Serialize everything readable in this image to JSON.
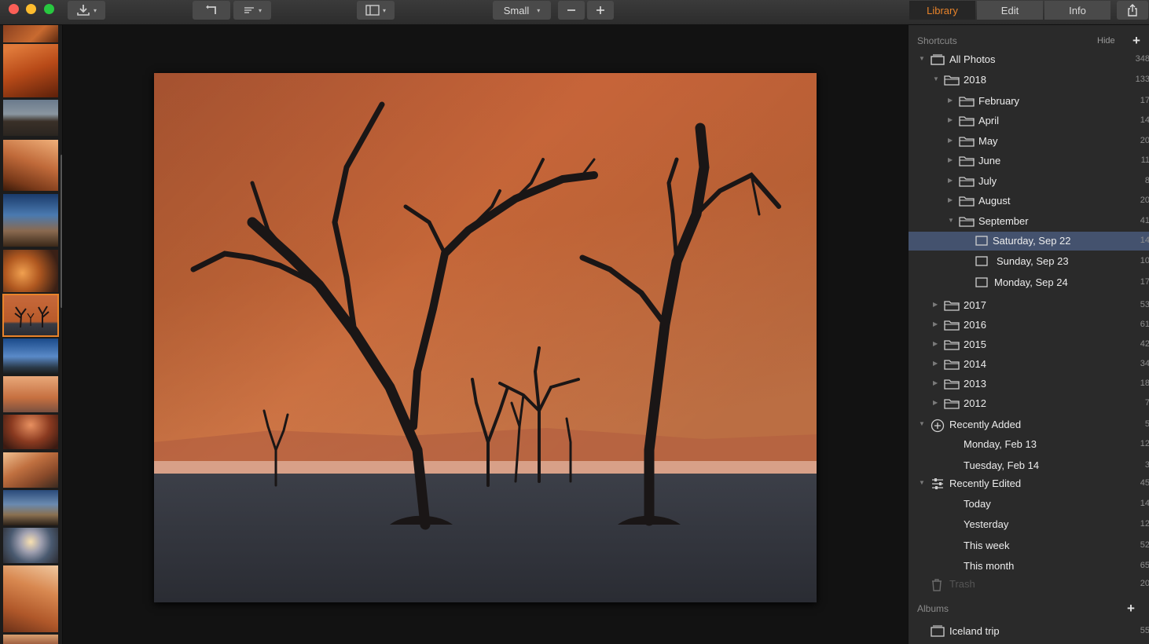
{
  "toolbar": {
    "size_select": "Small",
    "tabs": [
      {
        "label": "Library",
        "active": true
      },
      {
        "label": "Edit",
        "active": false
      },
      {
        "label": "Info",
        "active": false
      }
    ]
  },
  "colors": {
    "accent": "#e8832a",
    "selection": "#44526e",
    "sidebar_bg": "#2a2a2a",
    "viewer_bg": "#121212"
  },
  "filmstrip": {
    "selected_index": 6,
    "thumbnails": [
      "desert-dune-top",
      "desert-dune",
      "car-in-desert",
      "sand-dunes",
      "lightning-landscape",
      "abandoned-room",
      "dead-trees",
      "blue-sky-tree",
      "desert-trees",
      "rock-arch",
      "dune-ridge",
      "storm-clouds",
      "sunbeam-rocks",
      "orange-dune",
      "dune-bottom"
    ]
  },
  "sidebar": {
    "shortcuts_header": "Shortcuts",
    "hide_label": "Hide",
    "tree": [
      {
        "label": "All Photos",
        "count": "348",
        "icon": "photos-stack-icon"
      },
      {
        "label": "2018",
        "count": "133",
        "icon": "folder-icon"
      },
      {
        "label": "February",
        "count": "17",
        "icon": "folder-icon"
      },
      {
        "label": "April",
        "count": "14",
        "icon": "folder-icon"
      },
      {
        "label": "May",
        "count": "20",
        "icon": "folder-icon"
      },
      {
        "label": "June",
        "count": "11",
        "icon": "folder-icon"
      },
      {
        "label": "July",
        "count": "8",
        "icon": "folder-icon"
      },
      {
        "label": "August",
        "count": "20",
        "icon": "folder-icon"
      },
      {
        "label": "September",
        "count": "41",
        "icon": "folder-icon"
      },
      {
        "label": "Saturday, Sep 22",
        "count": "14",
        "icon": "day-icon",
        "selected": true
      },
      {
        "label": "Sunday, Sep 23",
        "count": "10",
        "icon": "day-icon"
      },
      {
        "label": "Monday, Sep 24",
        "count": "17",
        "icon": "day-icon"
      },
      {
        "label": "2017",
        "count": "53",
        "icon": "folder-icon"
      },
      {
        "label": "2016",
        "count": "61",
        "icon": "folder-icon"
      },
      {
        "label": "2015",
        "count": "42",
        "icon": "folder-icon"
      },
      {
        "label": "2014",
        "count": "34",
        "icon": "folder-icon"
      },
      {
        "label": "2013",
        "count": "18",
        "icon": "folder-icon"
      },
      {
        "label": "2012",
        "count": "7",
        "icon": "folder-icon"
      },
      {
        "label": "Recently Added",
        "count": "5",
        "icon": "plus-circle-icon"
      },
      {
        "label": "Monday, Feb 13",
        "count": "12",
        "icon": ""
      },
      {
        "label": "Tuesday, Feb 14",
        "count": "3",
        "icon": ""
      },
      {
        "label": "Recently Edited",
        "count": "45",
        "icon": "sliders-icon"
      },
      {
        "label": "Today",
        "count": "14",
        "icon": ""
      },
      {
        "label": "Yesterday",
        "count": "12",
        "icon": ""
      },
      {
        "label": "This week",
        "count": "52",
        "icon": ""
      },
      {
        "label": "This month",
        "count": "65",
        "icon": ""
      },
      {
        "label": "Trash",
        "count": "20",
        "icon": "trash-icon"
      }
    ],
    "albums_header": "Albums",
    "albums": [
      {
        "label": "Iceland trip",
        "count": "55",
        "icon": "album-icon"
      }
    ]
  }
}
